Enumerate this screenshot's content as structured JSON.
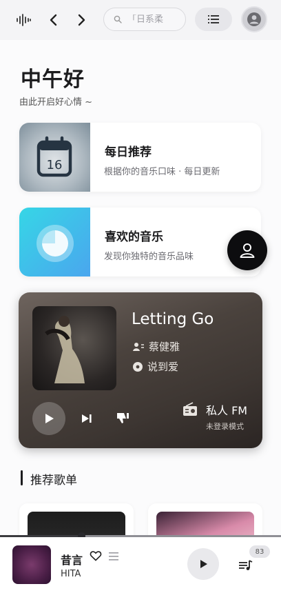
{
  "header": {
    "search_placeholder": "「日系柔",
    "icons": [
      "soundwave-icon",
      "chevron-left-icon",
      "chevron-right-icon",
      "search-icon",
      "list-icon",
      "user-avatar-icon"
    ]
  },
  "home": {
    "greeting": "中午好",
    "subtitle": "由此开启好心情 ~"
  },
  "cards": [
    {
      "title": "每日推荐",
      "subtitle": "根据你的音乐口味 · 每日更新",
      "icon": "calendar-icon",
      "calendar_day": "16"
    },
    {
      "title": "喜欢的音乐",
      "subtitle": "发现你独特的音乐品味",
      "icon": "pie-icon"
    }
  ],
  "fm": {
    "song": "Letting Go",
    "artist": "蔡健雅",
    "album": "说到爱",
    "label": "私人 FM",
    "mode": "未登录模式"
  },
  "section": {
    "title": "推荐歌单"
  },
  "player": {
    "title": "昔言",
    "artist": "HITA",
    "queue_count": "83",
    "progress": 0.29
  },
  "colors": {
    "background": "#f4f4f6",
    "panel": "#fbfbfc",
    "fm_card": "#4a423d",
    "accent_dark": "#0d0d0f"
  }
}
